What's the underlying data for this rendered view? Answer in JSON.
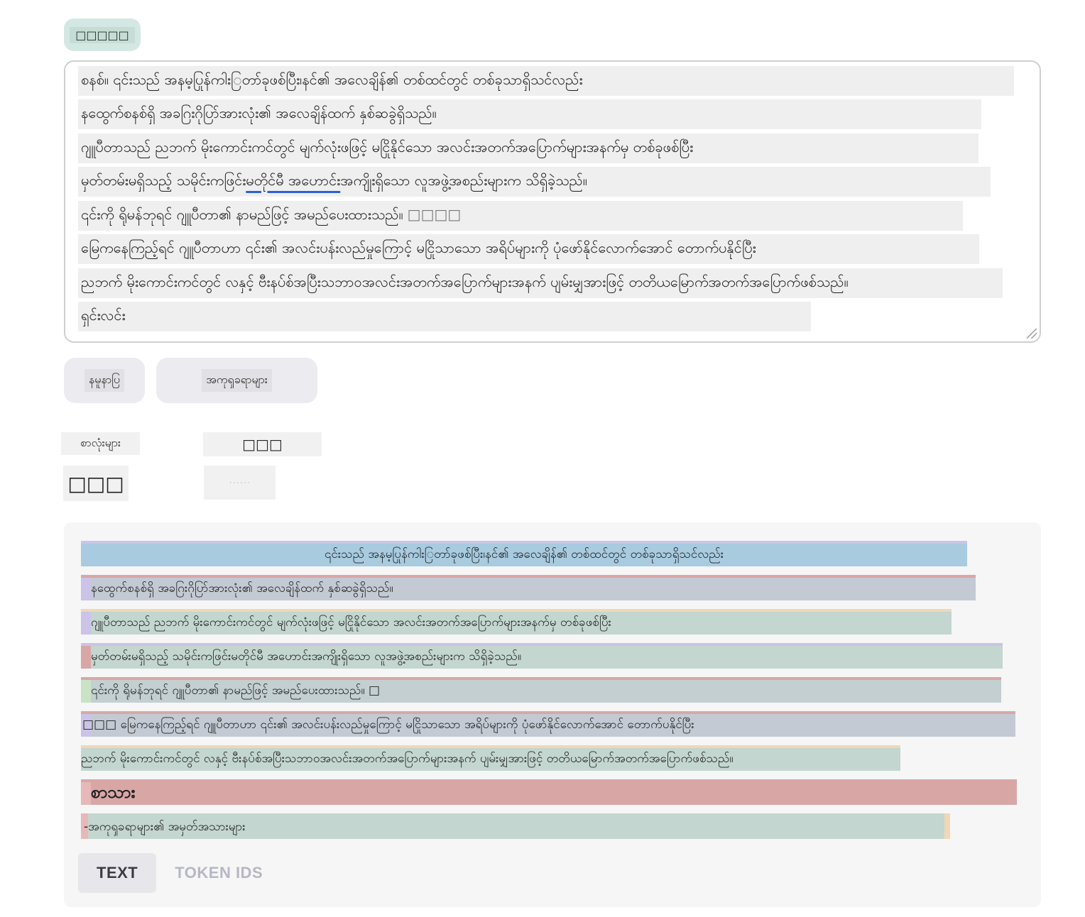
{
  "model_button": {
    "label": "□□□□□"
  },
  "input": {
    "lines": [
      "စနစ်။ ၎င်းသည် အနမ့ပြုန်ကါးြတာ်ခုဖစ်ပြီး၊နင်၏ အလေချိန်၏ တစ်ထင်တွင် တစ်ခုသာရှိသင်လည်း",
      "နထွေက်စနစ်ရှိ အခဂြးဂိုပြာ်အားလုံး၏ အလေချိန်ထက် နှစ်ဆခွဲရှိသည်။",
      "ဂျူပီတာသည် ညဘက် မိုးကောင်းကင်တွင် မျက်လုံးဖဖြင့် မငြိုနိုင်သော အလင်းအတက်အပြောက်များအနက်မှ တစ်ခုဖစ်ပြီး",
      "မှတ်တမ်းမရှိသည့် သမိုင်းကဖြင်းမတိုင်မီ အဟောင်းအကျိုးရှိသော လူအဖွဲ့အစည်းများက သိရှိခဲ့သည်။",
      "၎င်းကို ရိုမန်ဘုရင် ဂျူပီတာ၏ နာမည်ဖြင့် အမည်ပေးထားသည်။",
      "မြေကနေကြည့်ရင် ဂျူပီတာဟာ ၎င်း၏ အလင်းပန်းလည်မှုကြောင့် မငြိုသာသော အရိပ်များကို ပုံဖော်နိုင်လောက်အောင် တောက်ပနိုင်ပြီး",
      "ညဘက် မိုးကောင်းကင်တွင် လနှင့် ဗီးနပ်စ်အပြီးသဘာ၀အလင်းအတက်အပြောက်များအနက် ပျမ်းမျှအားဖြင့် တတိယမြောက်အတက်အပြောက်ဖစ်သည်။",
      "ရှင်းလင်း"
    ],
    "line4_underlined": "မတိုင်မီ အဟောင်း",
    "line5_trailing": "□□□□"
  },
  "buttons": {
    "clear": "နမူနာပြ",
    "examples": "အကုၡခရာများ"
  },
  "stats": {
    "chars_label": "စာလုံးများ",
    "tokens_label": "□□□",
    "chars_value": "□□□",
    "tokens_value": "· · · · · ·"
  },
  "output": {
    "lines": [
      "၎င်းသည် အနမ့ပြုန်ကါးြတာ်ခုဖစ်ပြီး၊နင်၏ အလေချိန်၏ တစ်ထင်တွင် တစ်ခုသာရှိသင်လည်း",
      "နထွေက်စနစ်ရှိ အခဂြးဂိုပြာ်အားလုံး၏ အလေချိန်ထက် နှစ်ဆခွဲရှိသည်။",
      "ဂျူပီတာသည် ညဘက် မိုးကောင်းကင်တွင် မျက်လုံးဖဖြင့် မငြိုနိုင်သော အလင်းအတက်အပြောက်များအနက်မှ တစ်ခုဖစ်ပြီး",
      "မှတ်တမ်းမရှိသည့် သမိုင်းကဖြင်းမတိုင်မီ အဟောင်းအကျိုးရှိသော လူအဖွဲ့အစည်းများက သိရှိခဲ့သည်။",
      "၎င်းကို ရိုမန်ဘုရင် ဂျူပီတာ၏ နာမည်ဖြင့် အမည်ပေးထားသည်။ □",
      "□□□ မြေကနေကြည့်ရင် ဂျူပီတာဟာ ၎င်း၏ အလင်းပန်းလည်မှုကြောင့် မငြိုသာသော အရိပ်များကို ပုံဖော်နိုင်လောက်အောင် တောက်ပနိုင်ပြီး",
      "ညဘက် မိုးကောင်းကင်တွင် လနှင့် ဗီးနပ်စ်အပြီးသဘာ၀အလင်းအတက်အပြောက်များအနက် ပျမ်းမျှအားဖြင့် တတိယမြောက်အတက်အပြောက်ဖစ်သည်။",
      "စာသား",
      "-အကုၡခရာများ၏ အမှတ်အသားများ"
    ]
  },
  "tabs": {
    "text": "TEXT",
    "token_ids": "TOKEN IDS"
  },
  "colors": {
    "token_blue": "#a8cbe0",
    "token_purple": "#cbc3e8",
    "token_green": "#c3d6cf",
    "token_red": "#d9a6a6",
    "token_peach": "#f1d7b6",
    "panel_bg": "#f6f6f6",
    "link_underline": "#2f5fd8"
  }
}
